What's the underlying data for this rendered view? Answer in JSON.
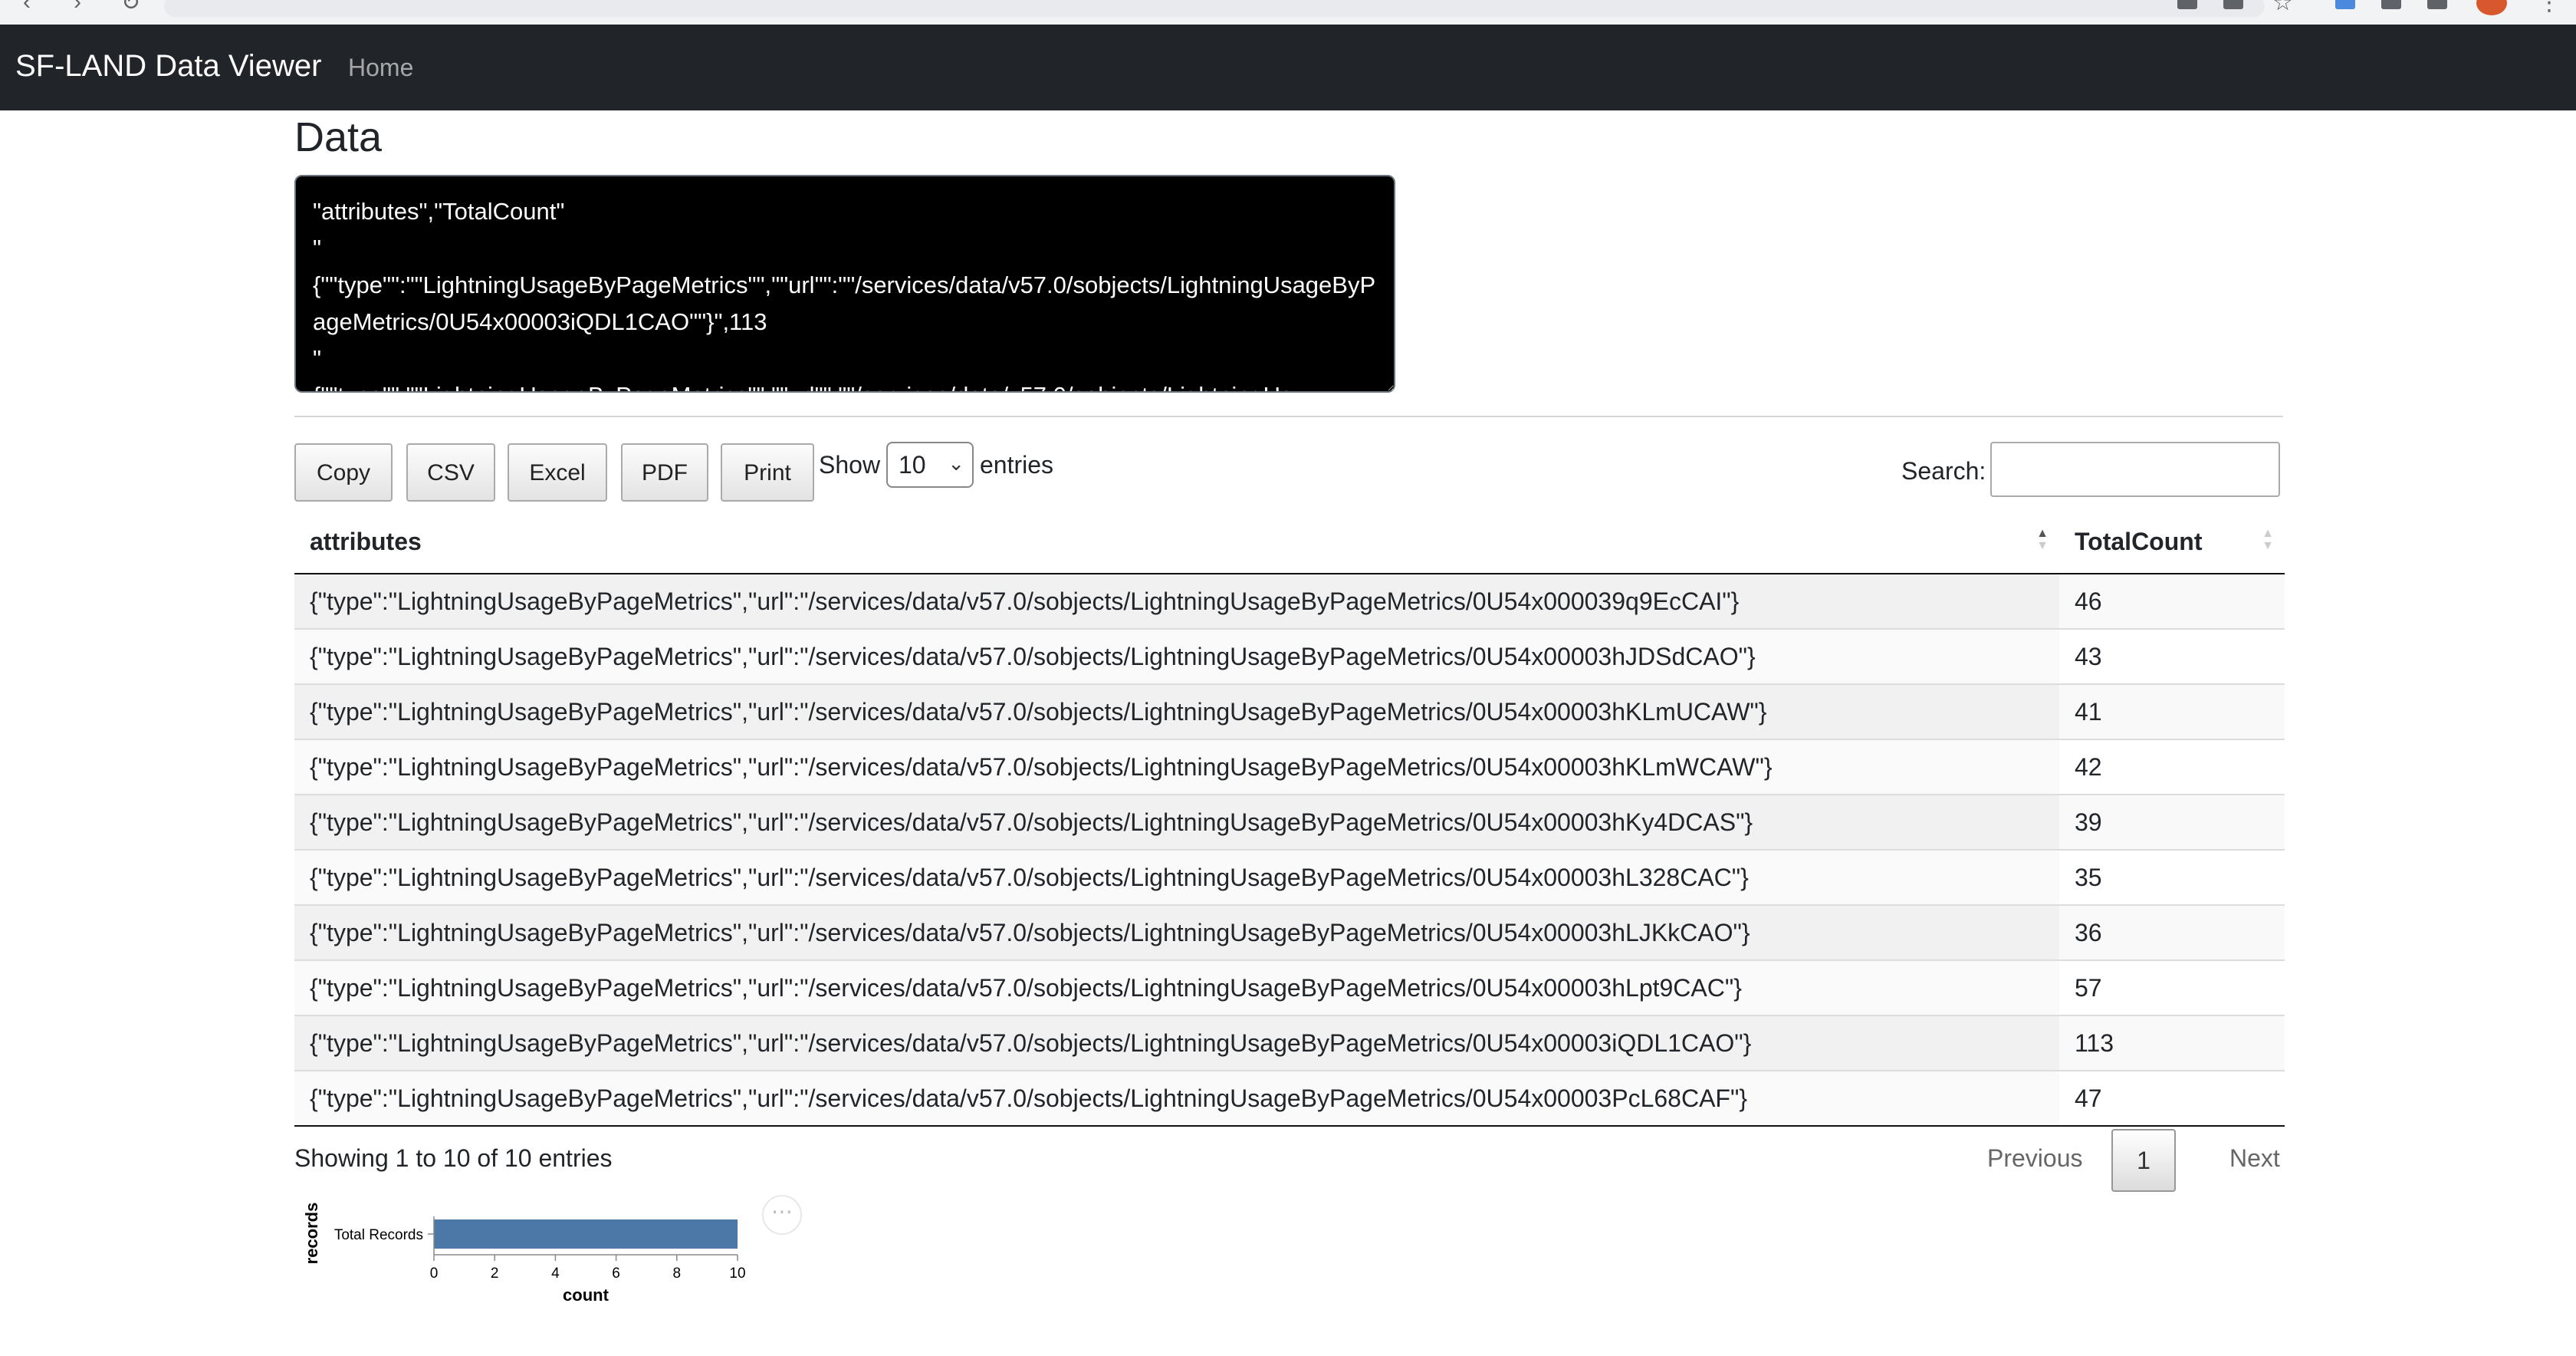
{
  "navbar": {
    "brand": "SF-LAND Data Viewer",
    "home_label": "Home"
  },
  "page": {
    "title": "Data",
    "raw_text": "\"attributes\",\"TotalCount\"\n\"\n{\"\"type\"\":\"\"LightningUsageByPageMetrics\"\",\"\"url\"\":\"\"/services/data/v57.0/sobjects/LightningUsageByPageMetrics/0U54x00003iQDL1CAO\"\"}\",113\n\"\n{\"\"type\"\":\"\"LightningUsageByPageMetrics\"\",\"\"url\"\":\"\"/services/data/v57.0/sobjects/LightningUs"
  },
  "toolbar": {
    "copy_label": "Copy",
    "csv_label": "CSV",
    "excel_label": "Excel",
    "pdf_label": "PDF",
    "print_label": "Print",
    "show_label": "Show",
    "page_length": "10",
    "entries_label": "entries",
    "search_label": "Search:"
  },
  "table": {
    "columns": [
      "attributes",
      "TotalCount"
    ],
    "rows": [
      {
        "attributes": "{\"type\":\"LightningUsageByPageMetrics\",\"url\":\"/services/data/v57.0/sobjects/LightningUsageByPageMetrics/0U54x000039q9EcCAI\"}",
        "total": "46"
      },
      {
        "attributes": "{\"type\":\"LightningUsageByPageMetrics\",\"url\":\"/services/data/v57.0/sobjects/LightningUsageByPageMetrics/0U54x00003hJDSdCAO\"}",
        "total": "43"
      },
      {
        "attributes": "{\"type\":\"LightningUsageByPageMetrics\",\"url\":\"/services/data/v57.0/sobjects/LightningUsageByPageMetrics/0U54x00003hKLmUCAW\"}",
        "total": "41"
      },
      {
        "attributes": "{\"type\":\"LightningUsageByPageMetrics\",\"url\":\"/services/data/v57.0/sobjects/LightningUsageByPageMetrics/0U54x00003hKLmWCAW\"}",
        "total": "42"
      },
      {
        "attributes": "{\"type\":\"LightningUsageByPageMetrics\",\"url\":\"/services/data/v57.0/sobjects/LightningUsageByPageMetrics/0U54x00003hKy4DCAS\"}",
        "total": "39"
      },
      {
        "attributes": "{\"type\":\"LightningUsageByPageMetrics\",\"url\":\"/services/data/v57.0/sobjects/LightningUsageByPageMetrics/0U54x00003hL328CAC\"}",
        "total": "35"
      },
      {
        "attributes": "{\"type\":\"LightningUsageByPageMetrics\",\"url\":\"/services/data/v57.0/sobjects/LightningUsageByPageMetrics/0U54x00003hLJKkCAO\"}",
        "total": "36"
      },
      {
        "attributes": "{\"type\":\"LightningUsageByPageMetrics\",\"url\":\"/services/data/v57.0/sobjects/LightningUsageByPageMetrics/0U54x00003hLpt9CAC\"}",
        "total": "57"
      },
      {
        "attributes": "{\"type\":\"LightningUsageByPageMetrics\",\"url\":\"/services/data/v57.0/sobjects/LightningUsageByPageMetrics/0U54x00003iQDL1CAO\"}",
        "total": "113"
      },
      {
        "attributes": "{\"type\":\"LightningUsageByPageMetrics\",\"url\":\"/services/data/v57.0/sobjects/LightningUsageByPageMetrics/0U54x00003PcL68CAF\"}",
        "total": "47"
      }
    ]
  },
  "footer": {
    "info": "Showing 1 to 10 of 10 entries",
    "previous_label": "Previous",
    "current_page": "1",
    "next_label": "Next"
  },
  "chart_data": {
    "type": "bar",
    "orientation": "horizontal",
    "categories": [
      "Total Records"
    ],
    "values": [
      10
    ],
    "xlabel": "count",
    "ylabel": "records",
    "xlim": [
      0,
      10
    ],
    "x_ticks": [
      "0",
      "2",
      "4",
      "6",
      "8",
      "10"
    ],
    "bar_color": "#4c78a8",
    "menu_label": "⋯"
  },
  "icons": {
    "sort_asc": "sort-asc-icon",
    "sort_both": "sort-both-icon",
    "select_arrow": "chevron-down-icon"
  }
}
